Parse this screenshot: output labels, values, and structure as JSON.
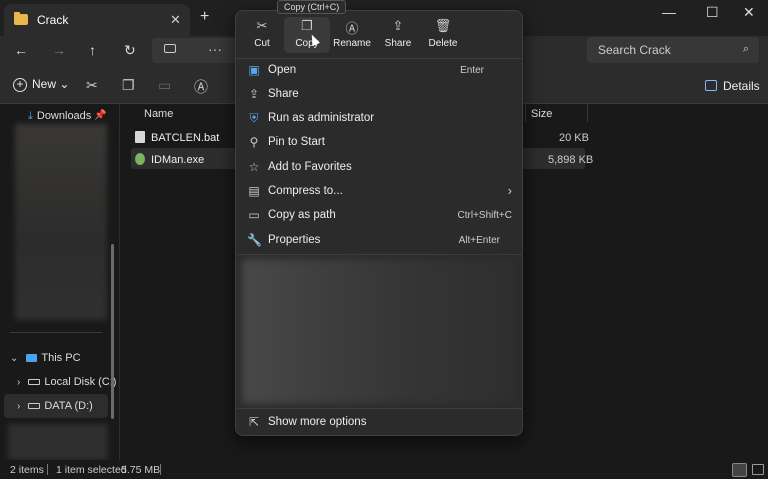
{
  "window": {
    "tab_title": "Crack",
    "tab_close": "✕",
    "new_tab": "+",
    "minimize": "—",
    "maximize": "☐",
    "close": "✕"
  },
  "nav": {
    "back": "←",
    "forward": "→",
    "up": "↑",
    "refresh": "↻",
    "more": "···",
    "search_placeholder": "Search Crack",
    "search_icon": "search-icon"
  },
  "commandbar": {
    "new_label": "New",
    "new_chevron": "⌄",
    "details_label": "Details"
  },
  "sidebar": {
    "downloads": "Downloads",
    "this_pc": "This PC",
    "local_disk": "Local Disk (C:)",
    "data_drive": "DATA (D:)"
  },
  "list": {
    "col_name": "Name",
    "col_size": "Size",
    "files": [
      {
        "name": "BATCLEN.bat",
        "size": "20 KB"
      },
      {
        "name": "IDMan.exe",
        "size": "5,898 KB"
      }
    ]
  },
  "status": {
    "items": "2 items",
    "selected": "1 item selected",
    "size": "5.75 MB"
  },
  "tooltip": "Copy (Ctrl+C)",
  "menu": {
    "quick_actions": [
      {
        "label": "Cut",
        "icon": "✂"
      },
      {
        "label": "Copy",
        "icon": "❐"
      },
      {
        "label": "Rename",
        "icon": "Ⓐ"
      },
      {
        "label": "Share",
        "icon": "⇪"
      },
      {
        "label": "Delete",
        "icon": "🗑"
      }
    ],
    "items": [
      {
        "label": "Open",
        "shortcut": "Enter"
      },
      {
        "label": "Share",
        "shortcut": ""
      },
      {
        "label": "Run as administrator",
        "shortcut": ""
      },
      {
        "label": "Pin to Start",
        "shortcut": ""
      },
      {
        "label": "Add to Favorites",
        "shortcut": ""
      },
      {
        "label": "Compress to...",
        "shortcut": "›"
      },
      {
        "label": "Copy as path",
        "shortcut": "Ctrl+Shift+C"
      },
      {
        "label": "Properties",
        "shortcut": "Alt+Enter"
      }
    ],
    "show_more": "Show more options"
  }
}
